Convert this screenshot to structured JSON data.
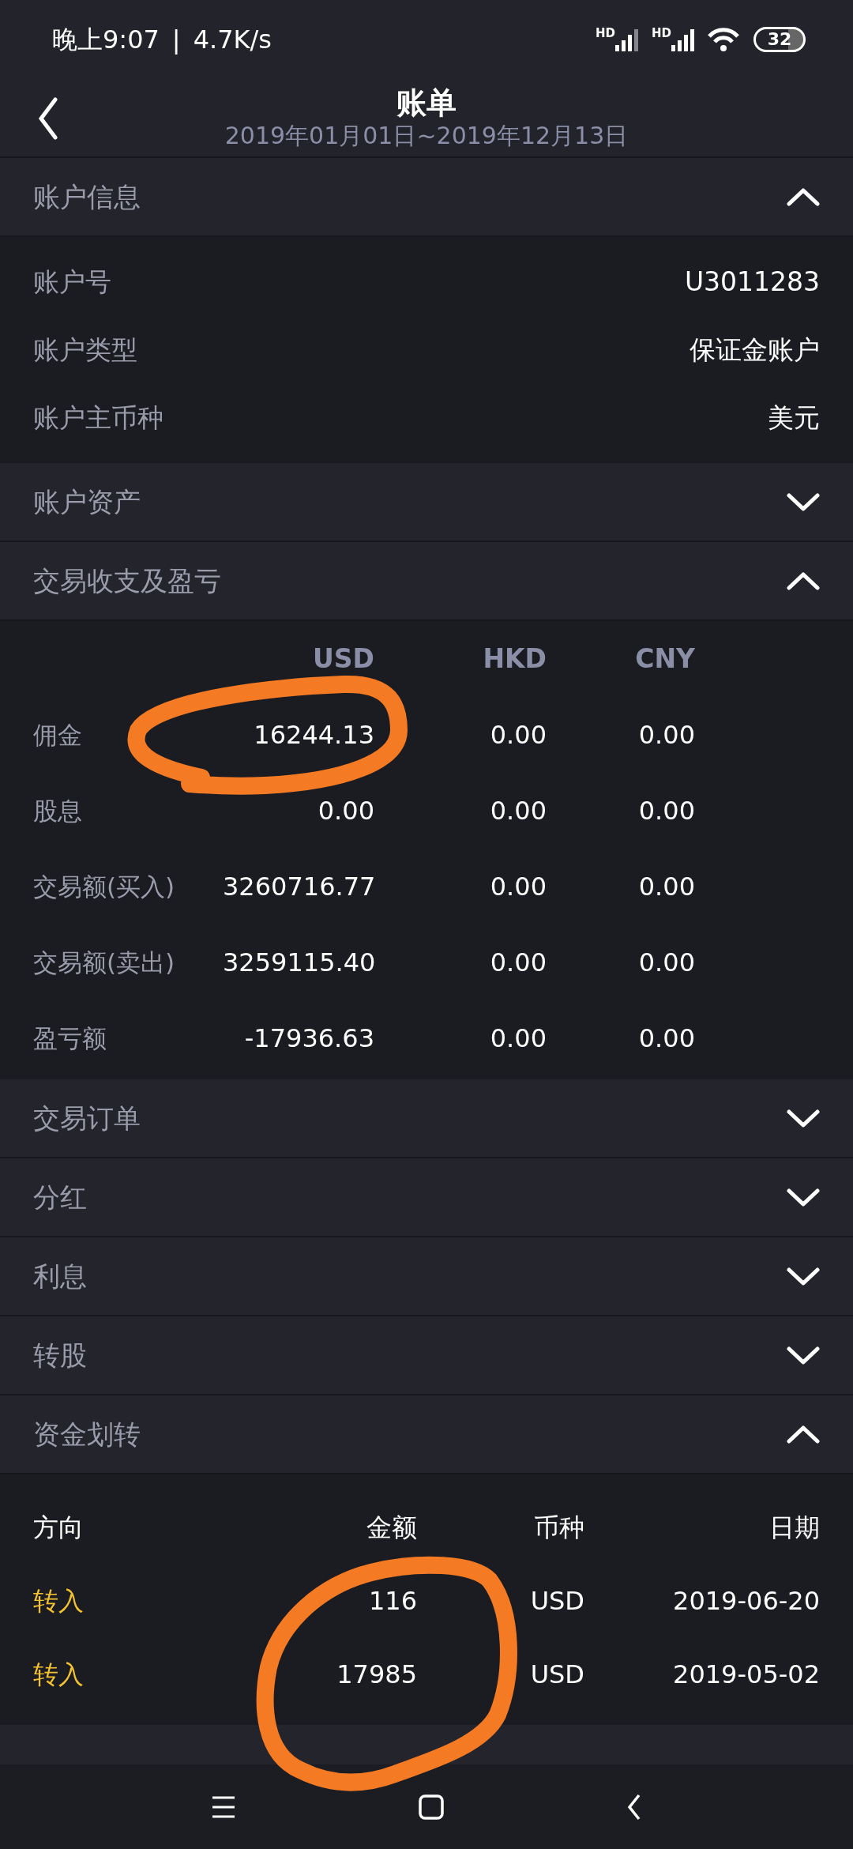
{
  "status_bar": {
    "time": "晚上9:07",
    "separator": "|",
    "speed": "4.7K/s",
    "signals": [
      {
        "label": "HD"
      },
      {
        "label": "HD"
      }
    ],
    "battery": "32"
  },
  "header": {
    "title": "账单",
    "subtitle": "2019年01月01日~2019年12月13日"
  },
  "sections": [
    {
      "title": "账户信息",
      "expanded": true,
      "kind": "info",
      "rows": [
        {
          "label": "账户号",
          "value": "U3011283"
        },
        {
          "label": "账户类型",
          "value": "保证金账户"
        },
        {
          "label": "账户主币种",
          "value": "美元"
        }
      ]
    },
    {
      "title": "账户资产",
      "expanded": false
    },
    {
      "title": "交易收支及盈亏",
      "expanded": true,
      "kind": "pnl",
      "circled": true,
      "columns": [
        "USD",
        "HKD",
        "CNY"
      ],
      "rows": [
        {
          "label": "佣金",
          "values": [
            "16244.13",
            "0.00",
            "0.00"
          ]
        },
        {
          "label": "股息",
          "values": [
            "0.00",
            "0.00",
            "0.00"
          ]
        },
        {
          "label": "交易额(买入)",
          "values": [
            "3260716.77",
            "0.00",
            "0.00"
          ]
        },
        {
          "label": "交易额(卖出)",
          "values": [
            "3259115.40",
            "0.00",
            "0.00"
          ]
        },
        {
          "label": "盈亏额",
          "values": [
            "-17936.63",
            "0.00",
            "0.00"
          ]
        }
      ]
    },
    {
      "title": "交易订单",
      "expanded": false
    },
    {
      "title": "分红",
      "expanded": false
    },
    {
      "title": "利息",
      "expanded": false
    },
    {
      "title": "转股",
      "expanded": false
    },
    {
      "title": "资金划转",
      "expanded": true,
      "kind": "transfers",
      "circled": true,
      "columns": [
        "方向",
        "金额",
        "币种",
        "日期"
      ],
      "rows": [
        {
          "direction": "转入",
          "amount": "116",
          "currency": "USD",
          "date": "2019-06-20"
        },
        {
          "direction": "转入",
          "amount": "17985",
          "currency": "USD",
          "date": "2019-05-02"
        }
      ]
    }
  ]
}
